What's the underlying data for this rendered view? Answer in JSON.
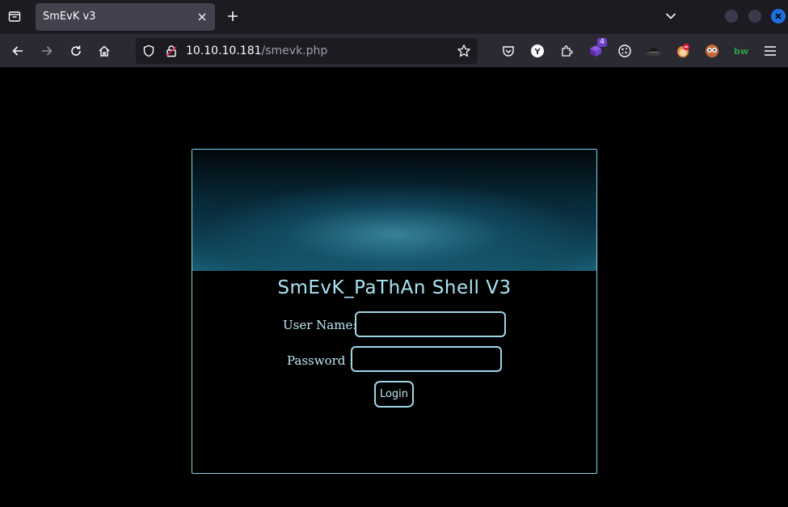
{
  "browser": {
    "tab": {
      "title": "SmEvK v3"
    },
    "url": {
      "host": "10.10.10.181",
      "path": "/smevk.php"
    },
    "extensions": [
      {
        "name": "pocket-icon"
      },
      {
        "name": "y-extension-icon",
        "label": "Y"
      },
      {
        "name": "extensions-icon"
      },
      {
        "name": "cube-extension-icon",
        "badge": "4"
      },
      {
        "name": "cookie-icon"
      },
      {
        "name": "hat-extension-icon"
      },
      {
        "name": "foxyproxy-icon"
      },
      {
        "name": "owl-extension-icon"
      },
      {
        "name": "bw-extension-icon",
        "label": "bw"
      }
    ]
  },
  "page": {
    "title": "SmEvK_PaThAn Shell V3",
    "username_label": "User Name:",
    "password_label": "Password :",
    "username_value": "",
    "password_value": "",
    "login_label": "Login"
  },
  "colors": {
    "accent": "#a9e6f3",
    "border": "#9fd6e6",
    "background": "#000000"
  }
}
